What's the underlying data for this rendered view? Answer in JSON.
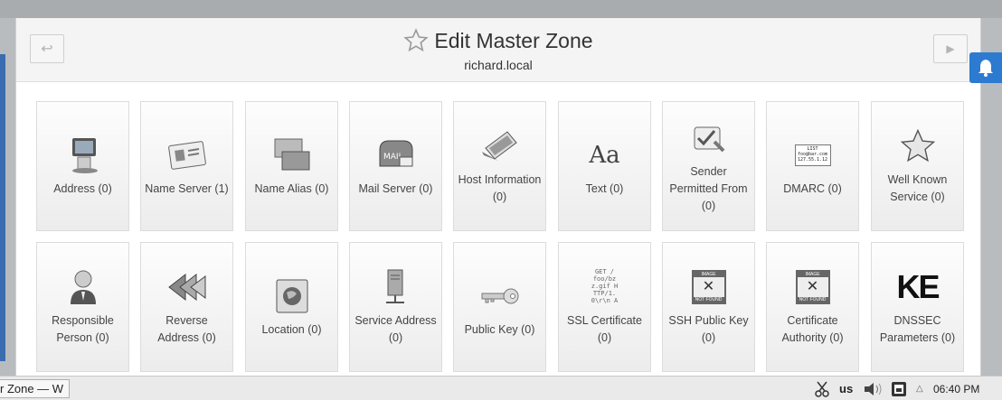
{
  "window": {
    "title": "Edit Master Zone",
    "subtitle": "richard.local",
    "back_icon": "arrow-back-icon",
    "forward_icon": "play-forward-icon",
    "bookmark_icon": "star-outline-icon",
    "notification_icon": "bell-icon"
  },
  "tiles": [
    {
      "label": "Address (0)",
      "icon": "computer-icon"
    },
    {
      "label": "Name Server (1)",
      "icon": "id-card-icon"
    },
    {
      "label": "Name Alias (0)",
      "icon": "stacked-windows-icon"
    },
    {
      "label": "Mail Server (0)",
      "icon": "mailbox-icon"
    },
    {
      "label": "Host Information (0)",
      "icon": "laptop-icon"
    },
    {
      "label": "Text (0)",
      "icon": "font-aa-icon"
    },
    {
      "label": "Sender Permitted From (0)",
      "icon": "check-wrench-icon"
    },
    {
      "label": "DMARC (0)",
      "icon": "envelope-card-icon"
    },
    {
      "label": "Well Known Service (0)",
      "icon": "star-icon"
    },
    {
      "label": "Responsible Person (0)",
      "icon": "person-icon"
    },
    {
      "label": "Reverse Address (0)",
      "icon": "rewind-icon"
    },
    {
      "label": "Location (0)",
      "icon": "globe-icon"
    },
    {
      "label": "Service Address (0)",
      "icon": "server-icon"
    },
    {
      "label": "Public Key (0)",
      "icon": "key-icon"
    },
    {
      "label": "SSL Certificate (0)",
      "icon": "certificate-text-icon"
    },
    {
      "label": "SSH Public Key (0)",
      "icon": "image-not-found-icon"
    },
    {
      "label": "Certificate Authority (0)",
      "icon": "image-not-found-icon"
    },
    {
      "label": "DNSSEC Parameters (0)",
      "icon": "ke-logo-icon"
    }
  ],
  "dmarc_icon_text": [
    "LIST",
    "foo@bar.com",
    "127.55.1.12"
  ],
  "ssl_icon_text": [
    "GET /",
    "foo/bz",
    "z.gif H",
    "TTP/1.",
    "0\\r\\n A"
  ],
  "image_not_found_text": [
    "IMAGE",
    "NOT FOUND"
  ],
  "ke_logo_text": "KE",
  "mailbox_text": "MAIL",
  "taskbar": {
    "task_label": "r Zone — W",
    "keyboard_layout": "us",
    "clock": "06:40 PM",
    "icons": [
      "scissors-icon",
      "volume-icon",
      "printer-icon",
      "chevron-up-icon"
    ]
  },
  "colors": {
    "accent": "#2c7bd0",
    "tile_border": "#dcdcdc"
  }
}
